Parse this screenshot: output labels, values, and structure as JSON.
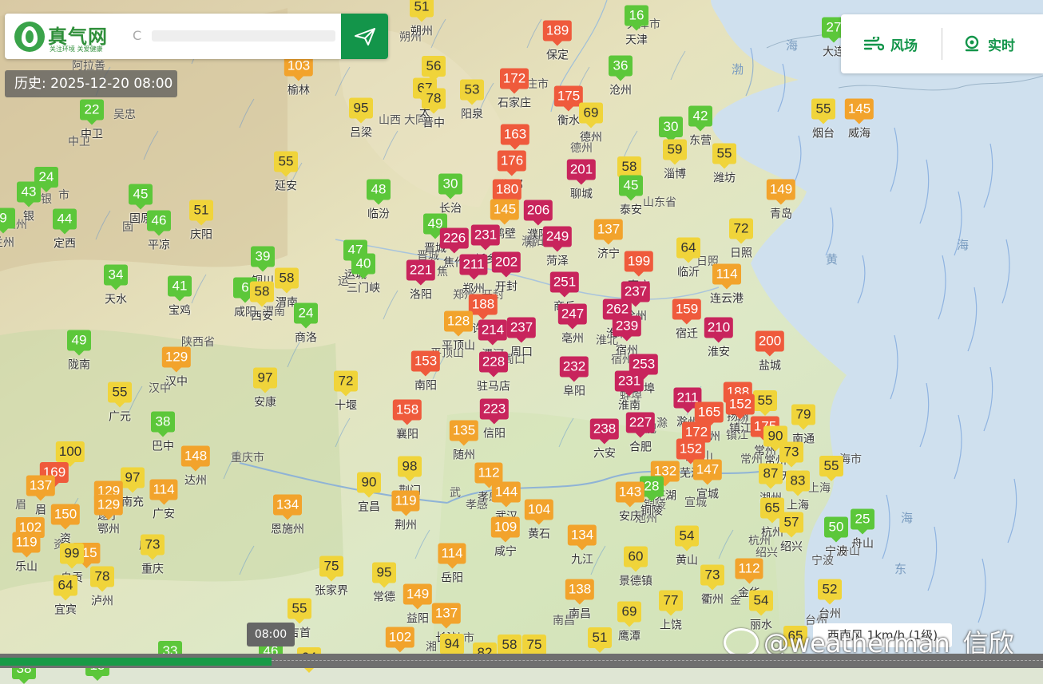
{
  "brand": {
    "name": "真气网",
    "slogan": "关注环境  关爱健康"
  },
  "search": {
    "placeholder": "",
    "glyph": "C"
  },
  "history_label": "历史: 2025-12-20 08:00",
  "tools": {
    "wind_label": "风场",
    "realtime_label": "实时"
  },
  "timeline": {
    "current_time": "08:00"
  },
  "wind_status": "西南风 1km/h (1级)",
  "watermark": "@weatherman_信欣",
  "colors": {
    "good": "#5cc73a",
    "moderate": "#f0d43a",
    "light": "#f2a32c",
    "medium": "#ef5a3c",
    "heavy": "#c8245c",
    "accent": "#13954a"
  },
  "map_labels": [
    {
      "text": "天津市"
    },
    {
      "text": "家庄市"
    },
    {
      "text": "山西"
    },
    {
      "text": "山东省"
    },
    {
      "text": "陕西省"
    },
    {
      "text": "重庆市"
    },
    {
      "text": "庆市"
    },
    {
      "text": "武"
    },
    {
      "text": "肥"
    },
    {
      "text": "海市"
    },
    {
      "text": "日照"
    },
    {
      "text": "上海"
    },
    {
      "text": "朔州"
    },
    {
      "text": "阿拉善"
    },
    {
      "text": "吴忠"
    },
    {
      "text": "中卫"
    },
    {
      "text": "固"
    },
    {
      "text": "兰州"
    },
    {
      "text": "银"
    },
    {
      "text": "市"
    },
    {
      "text": "运"
    },
    {
      "text": "焦"
    },
    {
      "text": "邢"
    },
    {
      "text": "东营"
    },
    {
      "text": "昌"
    },
    {
      "text": "宣城"
    },
    {
      "text": "杭州"
    },
    {
      "text": "绍兴"
    },
    {
      "text": "宁波"
    },
    {
      "text": "舟山"
    },
    {
      "text": "金"
    },
    {
      "text": "台州"
    },
    {
      "text": "南昌"
    },
    {
      "text": "长沙市"
    },
    {
      "text": "湘"
    },
    {
      "text": "孝感"
    },
    {
      "text": "铜陵"
    },
    {
      "text": "池州"
    },
    {
      "text": "滁"
    },
    {
      "text": "扬"
    },
    {
      "text": "常州"
    },
    {
      "text": "镇江"
    },
    {
      "text": "蚌埠"
    },
    {
      "text": "宿州"
    },
    {
      "text": "淮北"
    },
    {
      "text": "渭南"
    },
    {
      "text": "周口"
    },
    {
      "text": "平顶山"
    },
    {
      "text": "开封"
    },
    {
      "text": "郑州"
    },
    {
      "text": "濮阳"
    },
    {
      "text": "晋城"
    },
    {
      "text": "大同"
    },
    {
      "text": "德州"
    },
    {
      "text": "汉中"
    },
    {
      "text": "眉"
    },
    {
      "text": "资"
    },
    {
      "text": "南充"
    }
  ],
  "seas": [
    {
      "text": "渤"
    },
    {
      "text": "海"
    },
    {
      "text": "黄"
    },
    {
      "text": "海"
    },
    {
      "text": "东"
    },
    {
      "text": "海"
    }
  ],
  "stations": [
    {
      "v": "51",
      "c": "朔州"
    },
    {
      "v": "16",
      "c": "天津"
    },
    {
      "v": "189",
      "c": "保定"
    },
    {
      "v": "27",
      "c": "大连"
    },
    {
      "v": "103",
      "c": "榆林"
    },
    {
      "v": "56",
      "c": ""
    },
    {
      "v": "36",
      "c": "沧州"
    },
    {
      "v": "22",
      "c": "中卫"
    },
    {
      "v": "95",
      "c": "吕梁"
    },
    {
      "v": "67",
      "c": "太"
    },
    {
      "v": "78",
      "c": "晋中"
    },
    {
      "v": "53",
      "c": "阳泉"
    },
    {
      "v": "172",
      "c": "石家庄"
    },
    {
      "v": "175",
      "c": "衡水"
    },
    {
      "v": "69",
      "c": "德州"
    },
    {
      "v": "30",
      "c": ""
    },
    {
      "v": "42",
      "c": "东营"
    },
    {
      "v": "55",
      "c": "烟台"
    },
    {
      "v": "145",
      "c": "威海"
    },
    {
      "v": "163",
      "c": "邢台"
    },
    {
      "v": "58",
      "c": ""
    },
    {
      "v": "59",
      "c": "淄博"
    },
    {
      "v": "55",
      "c": "潍坊"
    },
    {
      "v": "24",
      "c": ""
    },
    {
      "v": "55",
      "c": "延安"
    },
    {
      "v": "176",
      "c": "邯郸"
    },
    {
      "v": "201",
      "c": "聊城"
    },
    {
      "v": "43",
      "c": "银"
    },
    {
      "v": "45",
      "c": "固原"
    },
    {
      "v": "48",
      "c": "临汾"
    },
    {
      "v": "30",
      "c": "长治"
    },
    {
      "v": "180",
      "c": "安阳"
    },
    {
      "v": "45",
      "c": "泰安"
    },
    {
      "v": "149",
      "c": "青岛"
    },
    {
      "v": "9",
      "c": "兰州"
    },
    {
      "v": "44",
      "c": "定西"
    },
    {
      "v": "46",
      "c": "平凉"
    },
    {
      "v": "51",
      "c": "庆阳"
    },
    {
      "v": "145",
      "c": "鹤壁"
    },
    {
      "v": "206",
      "c": "濮阳"
    },
    {
      "v": "49",
      "c": "晋城"
    },
    {
      "v": "226",
      "c": "焦作"
    },
    {
      "v": "231",
      "c": "新乡"
    },
    {
      "v": "249",
      "c": "菏泽"
    },
    {
      "v": "137",
      "c": "济宁"
    },
    {
      "v": "72",
      "c": "日照"
    },
    {
      "v": "47",
      "c": "运城"
    },
    {
      "v": "40",
      "c": "三门峡"
    },
    {
      "v": "39",
      "c": "铜川"
    },
    {
      "v": "64",
      "c": "临沂"
    },
    {
      "v": "199",
      "c": "枣庄"
    },
    {
      "v": "34",
      "c": "天水"
    },
    {
      "v": "221",
      "c": "洛阳"
    },
    {
      "v": "211",
      "c": "郑州"
    },
    {
      "v": "202",
      "c": "开封"
    },
    {
      "v": "58",
      "c": "渭南"
    },
    {
      "v": "114",
      "c": "连云港"
    },
    {
      "v": "41",
      "c": "宝鸡"
    },
    {
      "v": "6",
      "c": "咸阳"
    },
    {
      "v": "58",
      "c": "西安"
    },
    {
      "v": "251",
      "c": "商丘"
    },
    {
      "v": "237",
      "c": "徐州"
    },
    {
      "v": "188",
      "c": "许昌"
    },
    {
      "v": "262",
      "c": "淮北"
    },
    {
      "v": "24",
      "c": "商洛"
    },
    {
      "v": "247",
      "c": "亳州"
    },
    {
      "v": "159",
      "c": "宿迁"
    },
    {
      "v": "128",
      "c": "平顶山"
    },
    {
      "v": "214",
      "c": "漯河"
    },
    {
      "v": "237",
      "c": "周口"
    },
    {
      "v": "239",
      "c": "宿州"
    },
    {
      "v": "210",
      "c": "淮安"
    },
    {
      "v": "49",
      "c": "陇南"
    },
    {
      "v": "129",
      "c": "汉中"
    },
    {
      "v": "200",
      "c": "盐城"
    },
    {
      "v": "153",
      "c": "南阳"
    },
    {
      "v": "228",
      "c": "驻马店"
    },
    {
      "v": "232",
      "c": "阜阳"
    },
    {
      "v": "253",
      "c": "蚌埠"
    },
    {
      "v": "97",
      "c": "安康"
    },
    {
      "v": "72",
      "c": "十堰"
    },
    {
      "v": "231",
      "c": "淮南"
    },
    {
      "v": "55",
      "c": "广元"
    },
    {
      "v": "211",
      "c": "滁州"
    },
    {
      "v": "188",
      "c": "扬州"
    },
    {
      "v": "55",
      "c": ""
    },
    {
      "v": "165",
      "c": "泰州"
    },
    {
      "v": "158",
      "c": "襄阳"
    },
    {
      "v": "223",
      "c": "信阳"
    },
    {
      "v": "152",
      "c": "镇江"
    },
    {
      "v": "79",
      "c": "南通"
    },
    {
      "v": "38",
      "c": "巴中"
    },
    {
      "v": "135",
      "c": "随州"
    },
    {
      "v": "238",
      "c": "六安"
    },
    {
      "v": "227",
      "c": "合肥"
    },
    {
      "v": "172",
      "c": "马鞍山"
    },
    {
      "v": "175",
      "c": "常州"
    },
    {
      "v": "100",
      "c": ""
    },
    {
      "v": "148",
      "c": "达州"
    },
    {
      "v": "90",
      "c": "常州"
    },
    {
      "v": "152",
      "c": "芜湖"
    },
    {
      "v": "73",
      "c": "无锡"
    },
    {
      "v": "169",
      "c": ""
    },
    {
      "v": "55",
      "c": ""
    },
    {
      "v": "98",
      "c": "荆门"
    },
    {
      "v": "137",
      "c": "眉"
    },
    {
      "v": "97",
      "c": "南充"
    },
    {
      "v": "112",
      "c": "孝感"
    },
    {
      "v": "132",
      "c": "芜湖"
    },
    {
      "v": "147",
      "c": "宣城"
    },
    {
      "v": "87",
      "c": "湖州"
    },
    {
      "v": "83",
      "c": "上海"
    },
    {
      "v": "129",
      "c": "遂宁"
    },
    {
      "v": "114",
      "c": "广安"
    },
    {
      "v": "90",
      "c": "宜昌"
    },
    {
      "v": "134",
      "c": "恩施州"
    },
    {
      "v": "144",
      "c": "武汉"
    },
    {
      "v": "28",
      "c": "铜陵"
    },
    {
      "v": "143",
      "c": "安庆"
    },
    {
      "v": "119",
      "c": "荆州"
    },
    {
      "v": "102",
      "c": ""
    },
    {
      "v": "150",
      "c": "资"
    },
    {
      "v": "129",
      "c": "鄂州"
    },
    {
      "v": "104",
      "c": "黄石"
    },
    {
      "v": "65",
      "c": "杭州"
    },
    {
      "v": "115",
      "c": ""
    },
    {
      "v": "109",
      "c": "咸宁"
    },
    {
      "v": "134",
      "c": "九江"
    },
    {
      "v": "57",
      "c": "绍兴"
    },
    {
      "v": "50",
      "c": "宁波"
    },
    {
      "v": "25",
      "c": "舟山"
    },
    {
      "v": "119",
      "c": "乐山"
    },
    {
      "v": "99",
      "c": "自贡"
    },
    {
      "v": "73",
      "c": "重庆"
    },
    {
      "v": "54",
      "c": "黄山"
    },
    {
      "v": "114",
      "c": "岳阳"
    },
    {
      "v": "75",
      "c": "张家界"
    },
    {
      "v": "60",
      "c": "景德镇"
    },
    {
      "v": "73",
      "c": "衢州"
    },
    {
      "v": "112",
      "c": "金华"
    },
    {
      "v": "78",
      "c": "泸州"
    },
    {
      "v": "64",
      "c": "宜宾"
    },
    {
      "v": "95",
      "c": "常德"
    },
    {
      "v": "149",
      "c": "益阳"
    },
    {
      "v": "138",
      "c": "南昌"
    },
    {
      "v": "77",
      "c": "上饶"
    },
    {
      "v": "54",
      "c": "丽水"
    },
    {
      "v": "52",
      "c": "台州"
    },
    {
      "v": "55",
      "c": "吉首"
    },
    {
      "v": "137",
      "c": "长沙"
    },
    {
      "v": "69",
      "c": "鹰潭"
    },
    {
      "v": "33",
      "c": ""
    },
    {
      "v": "46",
      "c": ""
    },
    {
      "v": "102",
      "c": "湘潭"
    },
    {
      "v": "94",
      "c": ""
    },
    {
      "v": "82",
      "c": ""
    },
    {
      "v": "58",
      "c": ""
    },
    {
      "v": "75",
      "c": ""
    },
    {
      "v": "51",
      "c": ""
    },
    {
      "v": "64",
      "c": ""
    },
    {
      "v": "65",
      "c": ""
    },
    {
      "v": "15",
      "c": ""
    },
    {
      "v": "38",
      "c": ""
    }
  ]
}
